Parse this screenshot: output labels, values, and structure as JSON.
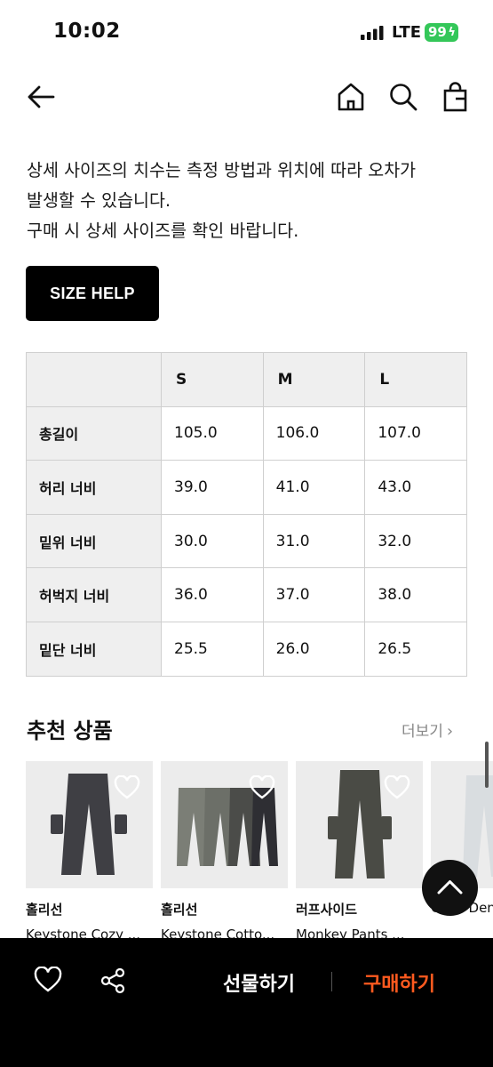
{
  "status_bar": {
    "time": "10:02",
    "network": "LTE",
    "battery": "99"
  },
  "notice": {
    "lines": [
      "상세 사이즈의 치수는 측정 방법과 위치에 따라 오차가",
      "발생할 수 있습니다.",
      "구매 시 상세 사이즈를 확인 바랍니다."
    ]
  },
  "size_help_label": "SIZE HELP",
  "size_table": {
    "columns": [
      "S",
      "M",
      "L"
    ],
    "rows": [
      {
        "label": "총길이",
        "values": [
          "105.0",
          "106.0",
          "107.0"
        ]
      },
      {
        "label": "허리 너비",
        "values": [
          "39.0",
          "41.0",
          "43.0"
        ]
      },
      {
        "label": "밑위 너비",
        "values": [
          "30.0",
          "31.0",
          "32.0"
        ]
      },
      {
        "label": "허벅지 너비",
        "values": [
          "36.0",
          "37.0",
          "38.0"
        ]
      },
      {
        "label": "밑단 너비",
        "values": [
          "25.5",
          "26.0",
          "26.5"
        ]
      }
    ]
  },
  "recommend": {
    "title": "추천 상품",
    "more_label": "더보기",
    "items": [
      {
        "brand": "홀리선",
        "name": "Keystone Cozy ...",
        "color": "#3f3f44"
      },
      {
        "brand": "홀리선",
        "name": "Keystone Cotto...",
        "color": "#6c6f68"
      },
      {
        "brand": "러프사이드",
        "name": "Monkey Pants ...",
        "color": "#4a4b45"
      },
      {
        "brand": "",
        "name": "Cove Den",
        "color": "#d9dde0"
      }
    ]
  },
  "bottom_bar": {
    "gift_label": "선물하기",
    "buy_label": "구매하기"
  },
  "colors": {
    "buy": "#ff5a1f",
    "battery": "#34c759"
  }
}
